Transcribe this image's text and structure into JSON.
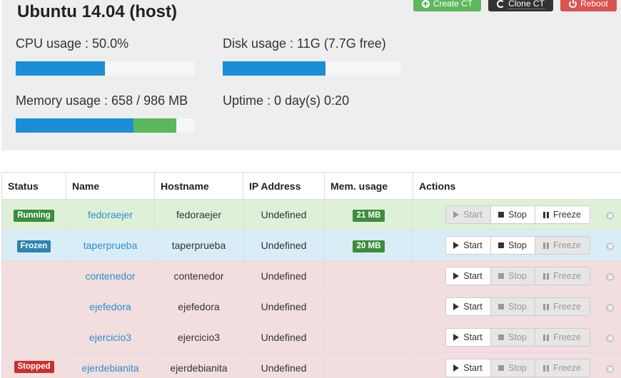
{
  "host": {
    "title": "Ubuntu 14.04 (host)",
    "buttons": {
      "create": "Create CT",
      "clone": "Clone CT",
      "reboot": "Reboot"
    },
    "cpu": {
      "label": "CPU usage : 50.0%",
      "fraction": 0.5
    },
    "disk": {
      "label": "Disk usage : 11G (7.7G free)",
      "fraction": 0.5746
    },
    "memory": {
      "label": "Memory usage : 658 / 986 MB",
      "used_fraction": 0.66,
      "cached_fraction": 0.24
    },
    "uptime": "Uptime : 0 day(s) 0:20"
  },
  "table": {
    "headers": {
      "status": "Status",
      "name": "Name",
      "hostname": "Hostname",
      "ip": "IP Address",
      "mem": "Mem. usage",
      "actions": "Actions"
    },
    "action_labels": {
      "start": "Start",
      "stop": "Stop",
      "freeze": "Freeze"
    },
    "status_labels": {
      "running": "Running",
      "frozen": "Frozen",
      "stopped": "Stopped"
    },
    "rows": [
      {
        "status": "running",
        "name": "fedoraejer",
        "hostname": "fedoraejer",
        "ip": "Undefined",
        "mem": "21 MB"
      },
      {
        "status": "frozen",
        "name": "taperprueba",
        "hostname": "taperprueba",
        "ip": "Undefined",
        "mem": "20 MB"
      },
      {
        "status": "stopped",
        "name": "contenedor",
        "hostname": "contenedor",
        "ip": "Undefined",
        "mem": ""
      },
      {
        "status": "stopped",
        "name": "ejefedora",
        "hostname": "ejefedora",
        "ip": "Undefined",
        "mem": ""
      },
      {
        "status": "stopped",
        "name": "ejercicio3",
        "hostname": "ejercicio3",
        "ip": "Undefined",
        "mem": ""
      },
      {
        "status": "stopped",
        "name": "ejerdebianita",
        "hostname": "ejerdebianita",
        "ip": "Undefined",
        "mem": ""
      }
    ]
  },
  "colors": {
    "accent_blue": "#1a8fd6",
    "success": "#5cb85c",
    "danger": "#d9534f",
    "dark": "#333333"
  }
}
